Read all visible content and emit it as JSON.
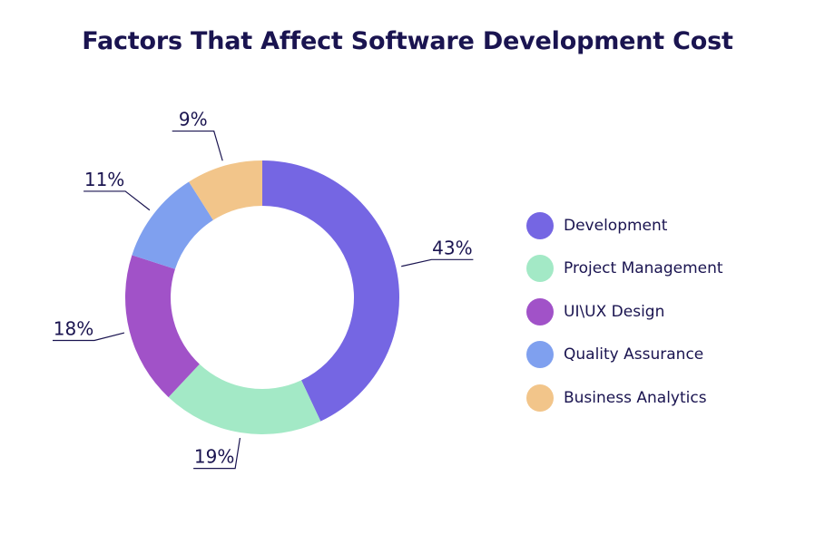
{
  "chart_data": {
    "type": "pie",
    "title": "Factors That Affect Software Development Cost",
    "categories": [
      "Development",
      "Project Management",
      "UI\\UX Design",
      "Quality Assurance",
      "Business Analytics"
    ],
    "values": [
      43,
      19,
      18,
      11,
      9
    ],
    "value_labels": [
      "43%",
      "19%",
      "18%",
      "11%",
      "9%"
    ],
    "colors": [
      "#7566e3",
      "#a3e9c6",
      "#a152c8",
      "#7fa0ef",
      "#f2c58a"
    ],
    "donut": true,
    "start": "top, clockwise",
    "legend_position": "right"
  }
}
